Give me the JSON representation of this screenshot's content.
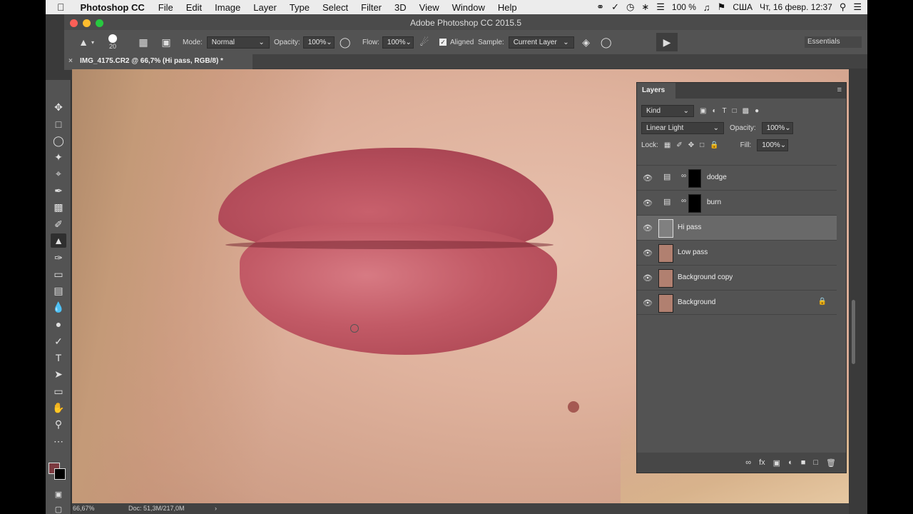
{
  "menubar": {
    "app_name": "Photoshop CC",
    "items": [
      "File",
      "Edit",
      "Image",
      "Layer",
      "Type",
      "Select",
      "Filter",
      "3D",
      "View",
      "Window",
      "Help"
    ],
    "battery": "100 %",
    "locale": "США",
    "clock": "Чт, 16 февр.  12:37"
  },
  "window": {
    "title": "Adobe Photoshop CC 2015.5"
  },
  "options": {
    "brush_size": "20",
    "mode_label": "Mode:",
    "mode_value": "Normal",
    "opacity_label": "Opacity:",
    "opacity_value": "100%",
    "flow_label": "Flow:",
    "flow_value": "100%",
    "aligned_label": "Aligned",
    "sample_label": "Sample:",
    "sample_value": "Current Layer",
    "workspace": "Essentials"
  },
  "document": {
    "tab_label": "IMG_4175.CR2 @ 66,7% (Hi pass, RGB/8) *",
    "zoom": "66,67%",
    "doc_size": "Doc: 51,3M/217,0M"
  },
  "layers_panel": {
    "title": "Layers",
    "filter_kind": "Kind",
    "blend_mode": "Linear Light",
    "opacity_label": "Opacity:",
    "opacity_value": "100%",
    "lock_label": "Lock:",
    "fill_label": "Fill:",
    "fill_value": "100%",
    "layers": [
      {
        "name": "dodge",
        "selected": false
      },
      {
        "name": "burn",
        "selected": false
      },
      {
        "name": "Hi pass",
        "selected": true
      },
      {
        "name": "Low pass",
        "selected": false
      },
      {
        "name": "Background copy",
        "selected": false
      },
      {
        "name": "Background",
        "selected": false
      }
    ]
  },
  "colors": {
    "foreground": "#7c3a40",
    "background": "#000000",
    "panel": "#535353"
  }
}
